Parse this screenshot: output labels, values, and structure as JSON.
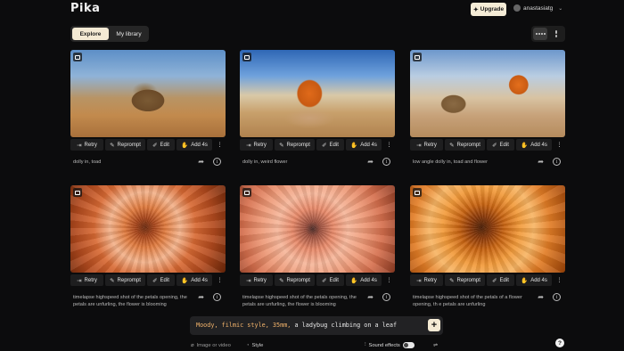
{
  "app": {
    "logo": "Pika"
  },
  "header": {
    "upgrade_label": "Upgrade",
    "username": "anastasiatg"
  },
  "tabs": [
    {
      "label": "Explore"
    },
    {
      "label": "My library"
    }
  ],
  "card_actions": {
    "retry": "Retry",
    "reprompt": "Reprompt",
    "edit": "Edit",
    "add": "Add 4s"
  },
  "cards": [
    {
      "caption": "dolly in, toad",
      "thumbnail": "toad in desert"
    },
    {
      "caption": "dolly in, weird flower",
      "thumbnail": "orange flower in desert"
    },
    {
      "caption": "low angle dolly in, toad and flower",
      "thumbnail": "toad and flower in desert"
    },
    {
      "caption": "timelapse highspeed shot of the petals opening, the petals are unfurling, the flower is blooming",
      "thumbnail": "orange dahlia close-up"
    },
    {
      "caption": "timelapse highspeed shot of the petals opening, the petals are unfurling, the flower is blooming",
      "thumbnail": "peach dahlia close-up"
    },
    {
      "caption": "timelapse highspeed shot of the petals of a flower opening, th e petals are unfurling",
      "thumbnail": "orange sunflower-like close-up"
    }
  ],
  "prompt": {
    "highlight": "Moody, filmic style, 35mm,",
    "rest": " a ladybug climbing on a leaf"
  },
  "bottom_bar": {
    "image_or_video": "Image or video",
    "style": "Style",
    "sound_effects": "Sound effects"
  },
  "help_label": "?",
  "colors": {
    "accent": "#f4ead4",
    "background": "#0c0c0d",
    "prompt_highlight": "#f2b36b"
  }
}
